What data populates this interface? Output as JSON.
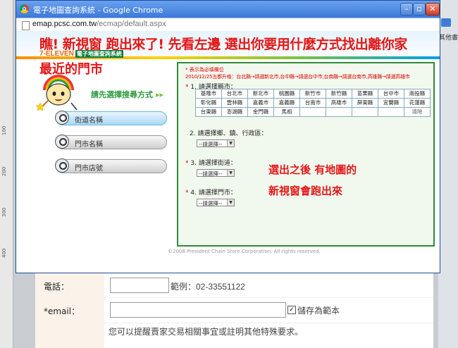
{
  "window": {
    "title": "電子地圖查詢系統 - Google Chrome",
    "url_host": "emap.pcsc.com.tw",
    "url_path": "/ecmap/default.aspx"
  },
  "banner": {
    "line1": "瞧! 新視窗 跑出來了! 先看左邊 選出你要用什麼方式找出離你家",
    "line2": "最近的門市",
    "logo_brand": "7-ELEVEN",
    "logo_sub": "電子地圖查詢系統"
  },
  "left": {
    "prompt": "請先選擇搜尋方式",
    "prompt_arrow": "▸▸",
    "menu": [
      {
        "label": "街道名稱"
      },
      {
        "label": "門市名稱"
      },
      {
        "label": "門市店號"
      }
    ]
  },
  "panel": {
    "required_note": "* 表示為必填欄位",
    "update_note": "2010/12/25五都升格：台北縣→請選新北市,台中縣→請選台中市,台南縣→請選台南市,高雄縣→請選高雄市",
    "step1": "1. 請選擇縣市：",
    "counties": [
      [
        "基隆市",
        "台北市",
        "新北市",
        "桃園縣",
        "新竹市",
        "新竹縣",
        "苗栗縣",
        "台中市",
        "南投縣"
      ],
      [
        "彰化縣",
        "雲林縣",
        "嘉義市",
        "嘉義縣",
        "台南市",
        "高雄市",
        "屏東縣",
        "宜蘭縣",
        "花蓮縣"
      ],
      [
        "台東縣",
        "澎湖縣",
        "金門縣",
        "馬祖",
        "",
        "",
        "",
        "",
        "清除"
      ]
    ],
    "step2": "2. 請選擇鄉、鎮、行政區：",
    "step3": "3. 請選擇街道：",
    "step4": "4. 請選擇門市：",
    "select_placeholder": "--請選擇--",
    "star": "*"
  },
  "note": {
    "line1": "選出之後 有地圖的",
    "line2": "新視窗會跑出來"
  },
  "copyright": "©2008 President Chain Store Corporation. All rights reserved.",
  "background": {
    "right_text": "其他書籤",
    "ruler": [
      "100",
      "200",
      "300",
      "400"
    ],
    "phone_label": "電話：",
    "phone_hint": "範例：02-33551122",
    "email_label": "*email：",
    "save_label": "儲存為範本",
    "save_check": "✓",
    "memo_hint": "您可以提醒賣家交易相關事宜或註明其他特殊要求。"
  }
}
